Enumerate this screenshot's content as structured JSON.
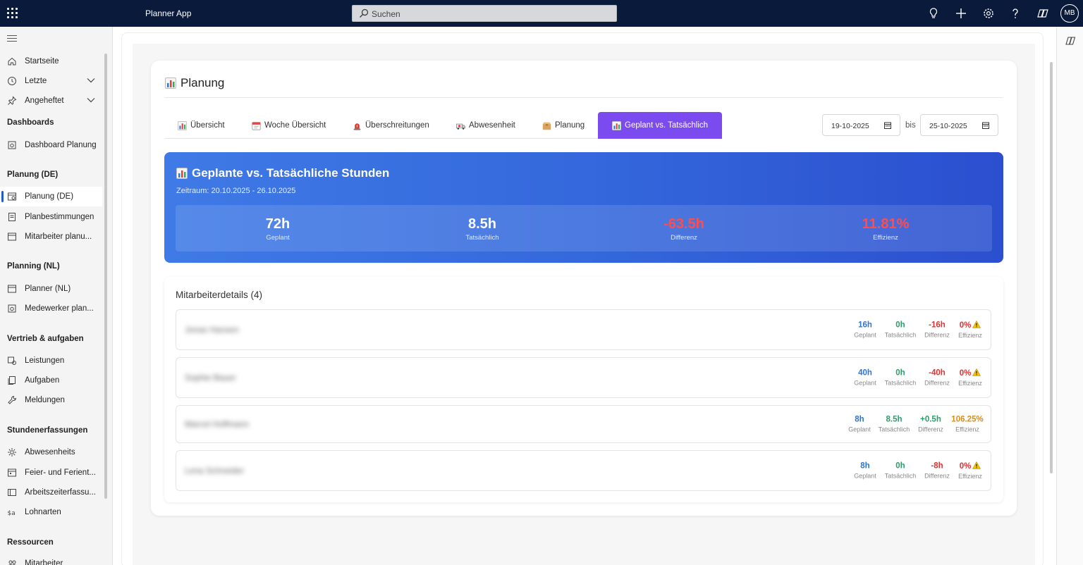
{
  "topbar": {
    "app_name": "Planner App",
    "search_placeholder": "Suchen",
    "icons": [
      "lightbulb-icon",
      "plus-icon",
      "settings-icon",
      "help-icon",
      "copilot-icon"
    ],
    "avatar_initials": "MB"
  },
  "sidebar": {
    "top_items": [
      {
        "label": "Startseite",
        "icon": "home-icon"
      },
      {
        "label": "Letzte",
        "icon": "clock-icon",
        "expandable": true
      },
      {
        "label": "Angeheftet",
        "icon": "pin-icon",
        "expandable": true
      }
    ],
    "groups": [
      {
        "title": "Dashboards",
        "items": [
          {
            "label": "Dashboard Planung"
          }
        ]
      },
      {
        "title": "Planung (DE)",
        "items": [
          {
            "label": "Planung (DE)",
            "active": true
          },
          {
            "label": "Planbestimmungen"
          },
          {
            "label": "Mitarbeiter planu..."
          }
        ]
      },
      {
        "title": "Planning (NL)",
        "items": [
          {
            "label": "Planner (NL)"
          },
          {
            "label": "Medewerker plan..."
          }
        ]
      },
      {
        "title": "Vertrieb & aufgaben",
        "items": [
          {
            "label": "Leistungen"
          },
          {
            "label": "Aufgaben"
          },
          {
            "label": "Meldungen"
          }
        ]
      },
      {
        "title": "Stundenerfassungen",
        "items": [
          {
            "label": "Abwesenheits"
          },
          {
            "label": "Feier- und Ferient..."
          },
          {
            "label": "Arbeitszeiterfassu..."
          },
          {
            "label": "Lohnarten"
          }
        ]
      },
      {
        "title": "Ressourcen",
        "items": [
          {
            "label": "Mitarbeiter"
          }
        ]
      }
    ]
  },
  "page": {
    "title": "Planung",
    "tabs": [
      {
        "label": "Übersicht",
        "icon": "chart-icon"
      },
      {
        "label": "Woche Übersicht",
        "icon": "calendar-icon"
      },
      {
        "label": "Überschreitungen",
        "icon": "siren-icon"
      },
      {
        "label": "Abwesenheit",
        "icon": "ambulance-icon"
      },
      {
        "label": "Planung",
        "icon": "box-icon"
      },
      {
        "label": "Geplant vs. Tatsächlich",
        "icon": "chart-icon",
        "active": true
      }
    ],
    "date_from": "19-10-2025",
    "date_separator": "bis",
    "date_to": "25-10-2025"
  },
  "summary": {
    "title": "Geplante vs. Tatsächliche Stunden",
    "period": "Zeitraum: 20.10.2025 - 26.10.2025",
    "stats": [
      {
        "value": "72h",
        "label": "Geplant"
      },
      {
        "value": "8.5h",
        "label": "Tatsächlich"
      },
      {
        "value": "-63.5h",
        "label": "Differenz",
        "negative": true
      },
      {
        "value": "11.81%",
        "label": "Effizienz",
        "negative": true
      }
    ]
  },
  "details": {
    "title": "Mitarbeiterdetails (4)",
    "metric_labels": {
      "planned": "Geplant",
      "actual": "Tatsächlich",
      "diff": "Differenz",
      "eff": "Effizienz"
    },
    "rows": [
      {
        "name": "Jonas Hansen",
        "planned": "16h",
        "actual": "0h",
        "diff": "-16h",
        "eff": "0%",
        "warning": true
      },
      {
        "name": "Sophie Bauer",
        "planned": "40h",
        "actual": "0h",
        "diff": "-40h",
        "eff": "0%",
        "warning": true
      },
      {
        "name": "Marcel Hoffmann",
        "planned": "8h",
        "actual": "8.5h",
        "diff": "+0.5h",
        "eff": "106.25%",
        "warning": false
      },
      {
        "name": "Lena Schneider",
        "planned": "8h",
        "actual": "0h",
        "diff": "-8h",
        "eff": "0%",
        "warning": true
      }
    ]
  },
  "colors": {
    "topbar": "#0a1a3a",
    "tab_active": "#7b4bf0",
    "banner_start": "#3f7ae6",
    "banner_end": "#2b4fcf",
    "negative": "#ff4d4d",
    "planned": "#2f74d0",
    "actual": "#2a9d6a",
    "diff_negative": "#e03030",
    "eff_high": "#e08a10"
  }
}
